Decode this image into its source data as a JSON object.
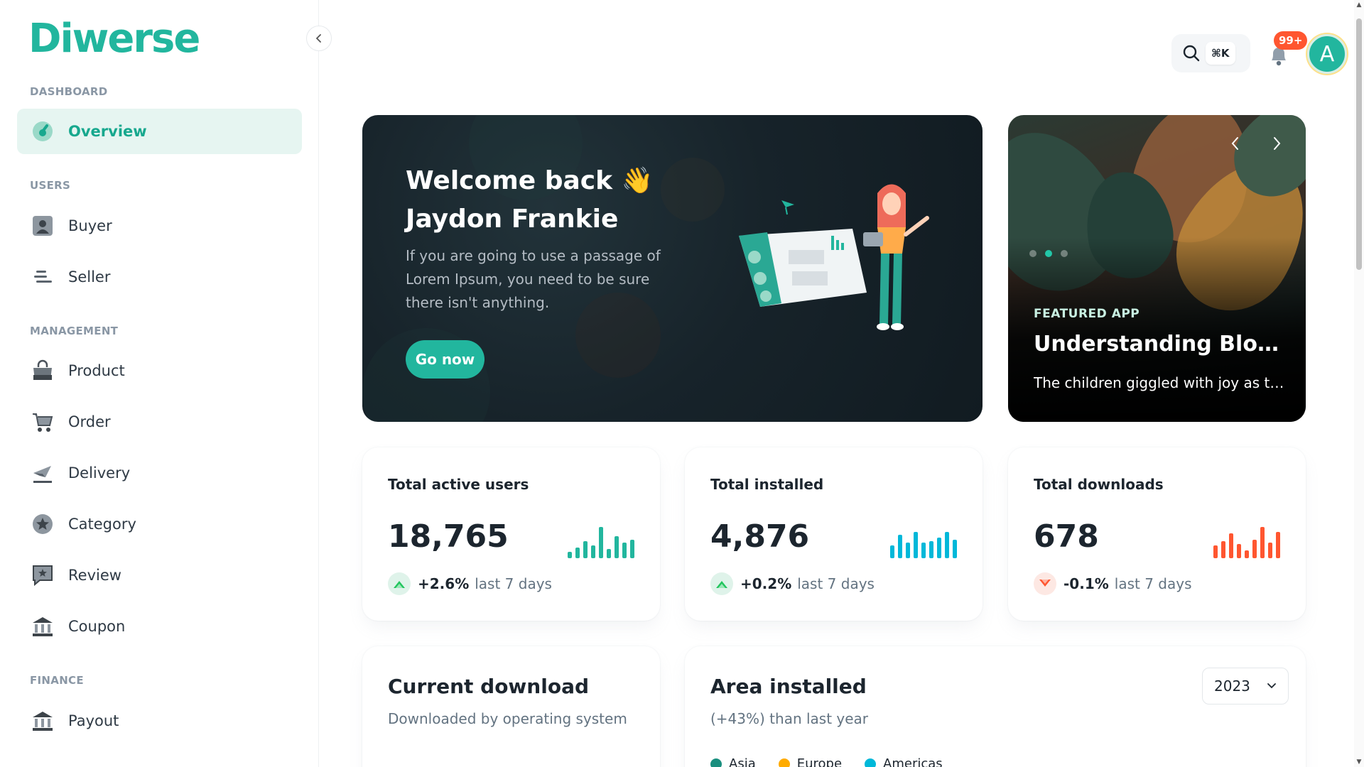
{
  "app": {
    "logo_text": "Diwerse",
    "brand_color": "#22b69e"
  },
  "sidebar": {
    "sections": [
      {
        "label": "DASHBOARD"
      },
      {
        "label": "USERS"
      },
      {
        "label": "MANAGEMENT"
      },
      {
        "label": "FINANCE"
      }
    ],
    "items": [
      {
        "label": "Overview",
        "icon": "dashboard-gauge-icon",
        "active": true
      },
      {
        "label": "Buyer",
        "icon": "user-icon"
      },
      {
        "label": "Seller",
        "icon": "lines-icon"
      },
      {
        "label": "Product",
        "icon": "shopping-bag-icon"
      },
      {
        "label": "Order",
        "icon": "cart-icon"
      },
      {
        "label": "Delivery",
        "icon": "plane-icon"
      },
      {
        "label": "Category",
        "icon": "star-icon"
      },
      {
        "label": "Review",
        "icon": "review-chat-icon"
      },
      {
        "label": "Coupon",
        "icon": "bank-icon"
      },
      {
        "label": "Payout",
        "icon": "bank-icon"
      }
    ]
  },
  "header": {
    "search_shortcut": "⌘K",
    "notification_count": "99+",
    "avatar_initial": "A"
  },
  "welcome": {
    "title_line1": "Welcome back 👋",
    "title_line2": "Jaydon Frankie",
    "description": "If you are going to use a passage of Lorem Ipsum, you need to be sure there isn't anything.",
    "button_label": "Go now"
  },
  "featured": {
    "kicker": "FEATURED APP",
    "title": "Understanding Blockchain Technology: Beyond Cryptocurrency",
    "description": "The children giggled with joy as they ran through the sprinklers on a hot summer day.",
    "slide_index": 2,
    "slide_count": 3
  },
  "stats": [
    {
      "title": "Total active users",
      "value": "18,765",
      "percent": "+2.6%",
      "period": "last 7 days",
      "trend": "up",
      "color": "#22b69e",
      "bars": [
        0.2,
        0.35,
        0.55,
        0.4,
        1.0,
        0.3,
        0.7,
        0.5,
        0.6
      ]
    },
    {
      "title": "Total installed",
      "value": "4,876",
      "percent": "+0.2%",
      "period": "last 7 days",
      "trend": "up",
      "color": "#00b8d9",
      "bars": [
        0.4,
        0.75,
        0.5,
        0.85,
        0.5,
        0.55,
        0.65,
        0.85,
        0.6
      ]
    },
    {
      "title": "Total downloads",
      "value": "678",
      "percent": "-0.1%",
      "period": "last 7 days",
      "trend": "down",
      "color": "#ff5630",
      "bars": [
        0.4,
        0.55,
        0.8,
        0.45,
        0.25,
        0.6,
        1.0,
        0.5,
        0.85
      ]
    }
  ],
  "current_download": {
    "title": "Current download",
    "subtitle": "Downloaded by operating system"
  },
  "area_installed": {
    "title": "Area installed",
    "subtitle": "(+43%) than last year",
    "year": "2023",
    "legend": [
      {
        "label": "Asia",
        "color": "#1a8f7f"
      },
      {
        "label": "Europe",
        "color": "#ffab00"
      },
      {
        "label": "Americas",
        "color": "#00b8d9"
      }
    ]
  }
}
